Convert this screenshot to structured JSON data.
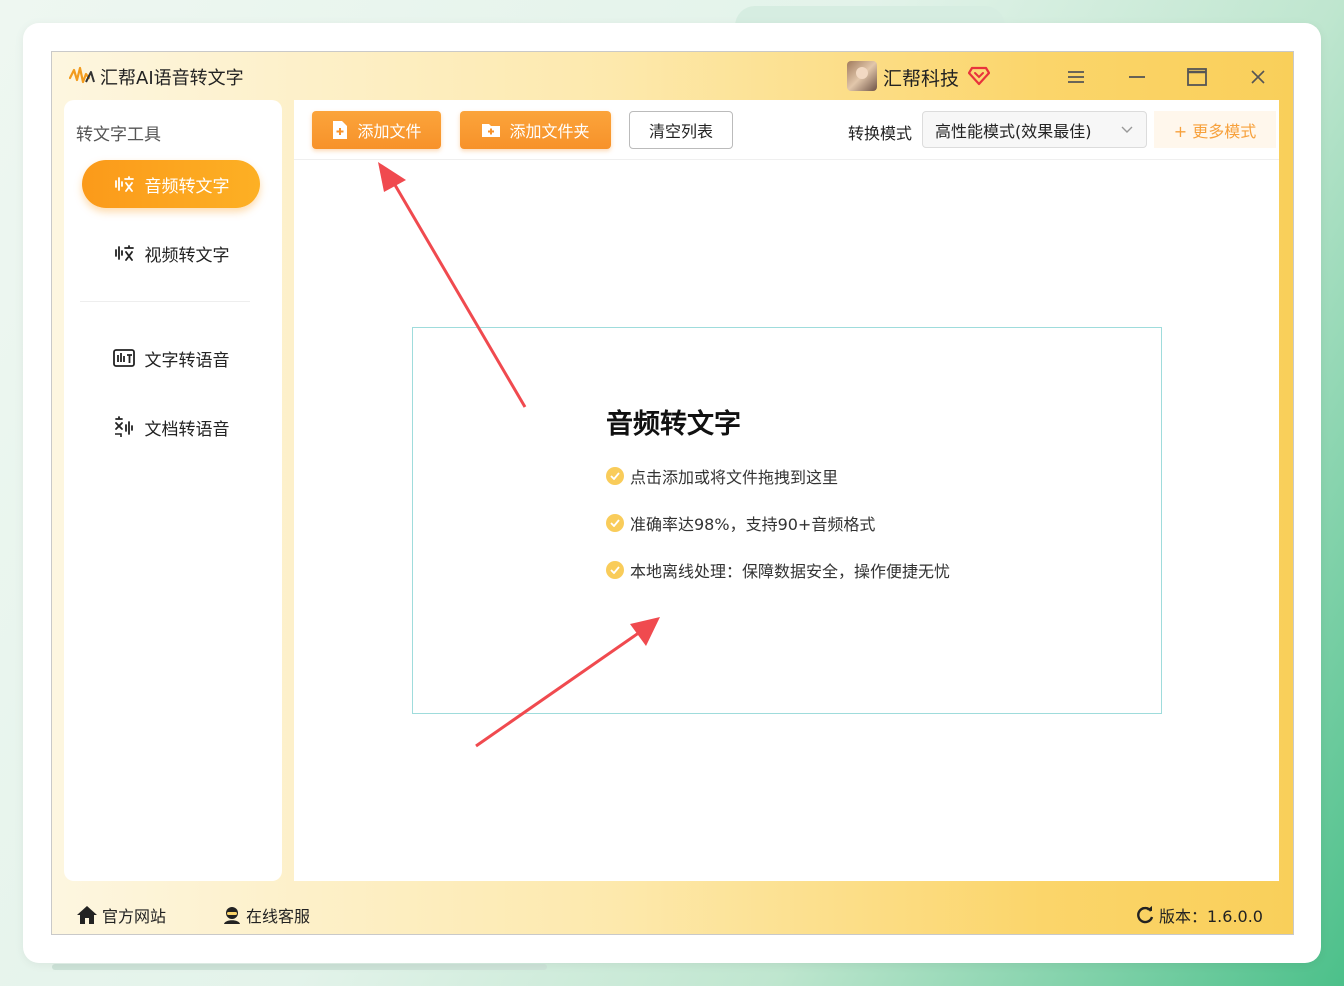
{
  "app": {
    "title": "汇帮AI语音转文字",
    "username": "汇帮科技",
    "colors": {
      "accent": "#f7922a",
      "vip": "#e8323c",
      "check": "#f9cc5a",
      "arrow": "#f04a4f"
    }
  },
  "sidebar": {
    "title": "转文字工具",
    "items": [
      {
        "label": "音频转文字",
        "icon": "audio-wave-icon",
        "active": true
      },
      {
        "label": "视频转文字",
        "icon": "video-wave-icon",
        "active": false
      },
      {
        "label": "文字转语音",
        "icon": "text-speech-icon",
        "active": false
      },
      {
        "label": "文档转语音",
        "icon": "doc-speech-icon",
        "active": false
      }
    ]
  },
  "toolbar": {
    "add_file": "添加文件",
    "add_folder": "添加文件夹",
    "clear_list": "清空列表",
    "mode_label": "转换模式",
    "mode_value": "高性能模式(效果最佳)",
    "more_modes": "+ 更多模式"
  },
  "dropzone": {
    "title": "音频转文字",
    "features": [
      "点击添加或将文件拖拽到这里",
      "准确率达98%，支持90+音频格式",
      "本地离线处理：保障数据安全，操作便捷无忧"
    ]
  },
  "footer": {
    "website": "官方网站",
    "service": "在线客服",
    "version": "版本：1.6.0.0"
  }
}
